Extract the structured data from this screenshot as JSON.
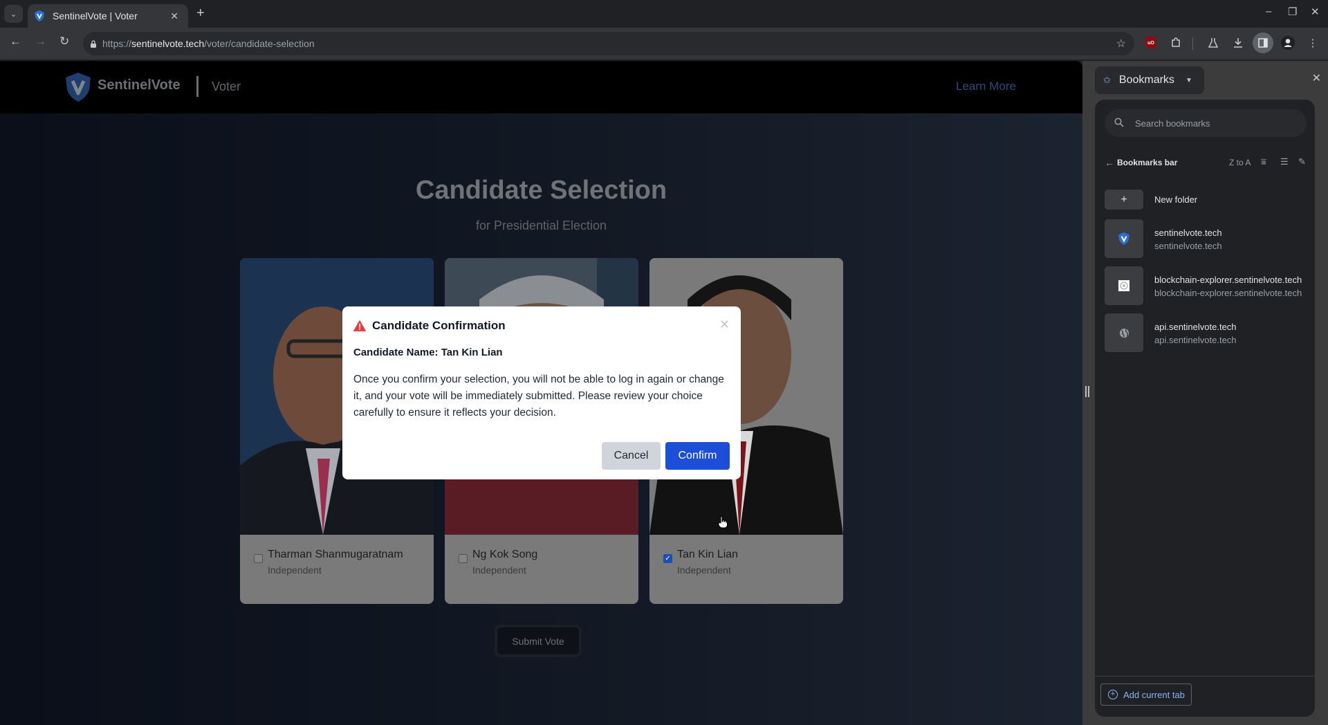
{
  "browser": {
    "tab_title": "SentinelVote | Voter",
    "url_scheme": "https://",
    "url_host": "sentinelvote.tech",
    "url_path": "/voter/candidate-selection",
    "icons": {
      "tab_search": "chevron-down-icon",
      "new_tab": "+",
      "minimize": "–",
      "restore": "❐",
      "close": "✕",
      "back": "←",
      "forward": "→",
      "reload": "↻",
      "bookmark_star": "☆",
      "extensions": "puzzle-icon",
      "labs": "flask-icon",
      "download": "download-icon",
      "side_panel": "side-panel-icon",
      "profile": "profile-icon",
      "menu": "⋮"
    }
  },
  "site": {
    "brand": "SentinelVote",
    "role": "Voter",
    "learn_more": "Learn More",
    "page_title": "Candidate Selection",
    "page_subtitle": "for Presidential Election",
    "submit_label": "Submit Vote",
    "colors": {
      "primary": "#1d4ed8",
      "logo": "#1e4b8a",
      "warning": "#e53e3e"
    }
  },
  "candidates": [
    {
      "name": "Tharman Shanmugaratnam",
      "party": "Independent",
      "selected": false
    },
    {
      "name": "Ng Kok Song",
      "party": "Independent",
      "selected": false
    },
    {
      "name": "Tan Kin Lian",
      "party": "Independent",
      "selected": true
    }
  ],
  "modal": {
    "title": "Candidate Confirmation",
    "candidate_line": "Candidate Name: Tan Kin Lian",
    "body": "Once you confirm your selection, you will not be able to log in again or change it, and your vote will be immediately submitted. Please review your choice carefully to ensure it reflects your decision.",
    "cancel_label": "Cancel",
    "confirm_label": "Confirm",
    "close_glyph": "✕"
  },
  "bookmarks_panel": {
    "header": "Bookmarks",
    "search_placeholder": "Search bookmarks",
    "folder": "Bookmarks bar",
    "sort_label": "Z to A",
    "new_folder": "New folder",
    "items": [
      {
        "title": "sentinelvote.tech",
        "url": "sentinelvote.tech",
        "icon": "sentinelvote-shield-icon"
      },
      {
        "title": "blockchain-explorer.sentinelvote.tech",
        "url": "blockchain-explorer.sentinelvote.tech",
        "icon": "blockchain-favicon-icon"
      },
      {
        "title": "api.sentinelvote.tech",
        "url": "api.sentinelvote.tech",
        "icon": "globe-icon"
      }
    ],
    "add_current_tab": "Add current tab"
  }
}
